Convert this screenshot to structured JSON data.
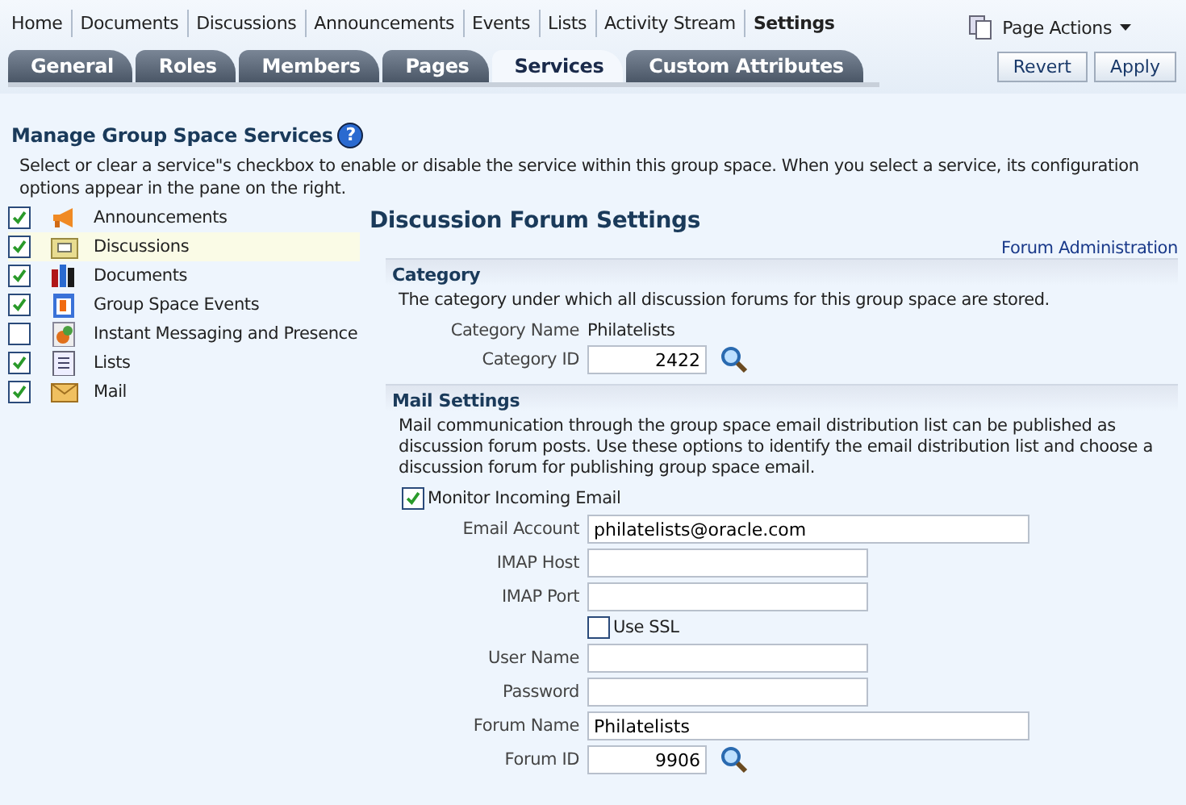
{
  "nav": [
    {
      "label": "Home",
      "selected": false
    },
    {
      "label": "Documents",
      "selected": false
    },
    {
      "label": "Discussions",
      "selected": false
    },
    {
      "label": "Announcements",
      "selected": false
    },
    {
      "label": "Events",
      "selected": false
    },
    {
      "label": "Lists",
      "selected": false
    },
    {
      "label": "Activity Stream",
      "selected": false
    },
    {
      "label": "Settings",
      "selected": true
    }
  ],
  "page_actions": "Page Actions",
  "tabs": [
    {
      "label": "General",
      "selected": false
    },
    {
      "label": "Roles",
      "selected": false
    },
    {
      "label": "Members",
      "selected": false
    },
    {
      "label": "Pages",
      "selected": false
    },
    {
      "label": "Services",
      "selected": true
    },
    {
      "label": "Custom Attributes",
      "selected": false
    }
  ],
  "buttons": [
    "Revert",
    "Apply"
  ],
  "section_title": "Manage Group Space Services",
  "help": "?",
  "description": "Select or clear a service\"s checkbox to enable or disable the service within this group space. When you select a service, its configuration options appear in the pane on the right.",
  "services": [
    {
      "label": "Announcements",
      "checked": true,
      "selected": false
    },
    {
      "label": "Discussions",
      "checked": true,
      "selected": true
    },
    {
      "label": "Documents",
      "checked": true,
      "selected": false
    },
    {
      "label": "Group Space Events",
      "checked": true,
      "selected": false
    },
    {
      "label": "Instant Messaging and Presence",
      "checked": false,
      "selected": false
    },
    {
      "label": "Lists",
      "checked": true,
      "selected": false
    },
    {
      "label": "Mail",
      "checked": true,
      "selected": false
    }
  ],
  "settings": {
    "title": "Discussion Forum Settings",
    "link": "Forum Administration",
    "category": {
      "title": "Category",
      "text": "The category under which all discussion forums for this group space are stored.",
      "name_label": "Category Name",
      "name_value": "Philatelists",
      "id_label": "Category ID",
      "id_value": "2422"
    },
    "mail": {
      "title": "Mail Settings",
      "text": "Mail communication through the group space email distribution list can be published as discussion forum posts. Use these options to identify the email distribution list and choose a discussion forum for publishing group space email.",
      "fields": [
        {
          "kind": "checkbox",
          "label": "Monitor Incoming Email",
          "checked": true
        },
        {
          "kind": "long",
          "label": "Email Account",
          "value": "philatelists@oracle.com"
        },
        {
          "kind": "text",
          "label": "IMAP Host"
        },
        {
          "kind": "text",
          "label": "IMAP Port"
        },
        {
          "kind": "option",
          "label": "Use SSL",
          "checked": false
        },
        {
          "kind": "text",
          "label": "User Name"
        },
        {
          "kind": "text",
          "label": "Password"
        },
        {
          "kind": "long",
          "label": "Forum Name",
          "value": "Philatelists"
        },
        {
          "kind": "lookup",
          "label": "Forum ID",
          "value": "9906"
        }
      ]
    }
  }
}
